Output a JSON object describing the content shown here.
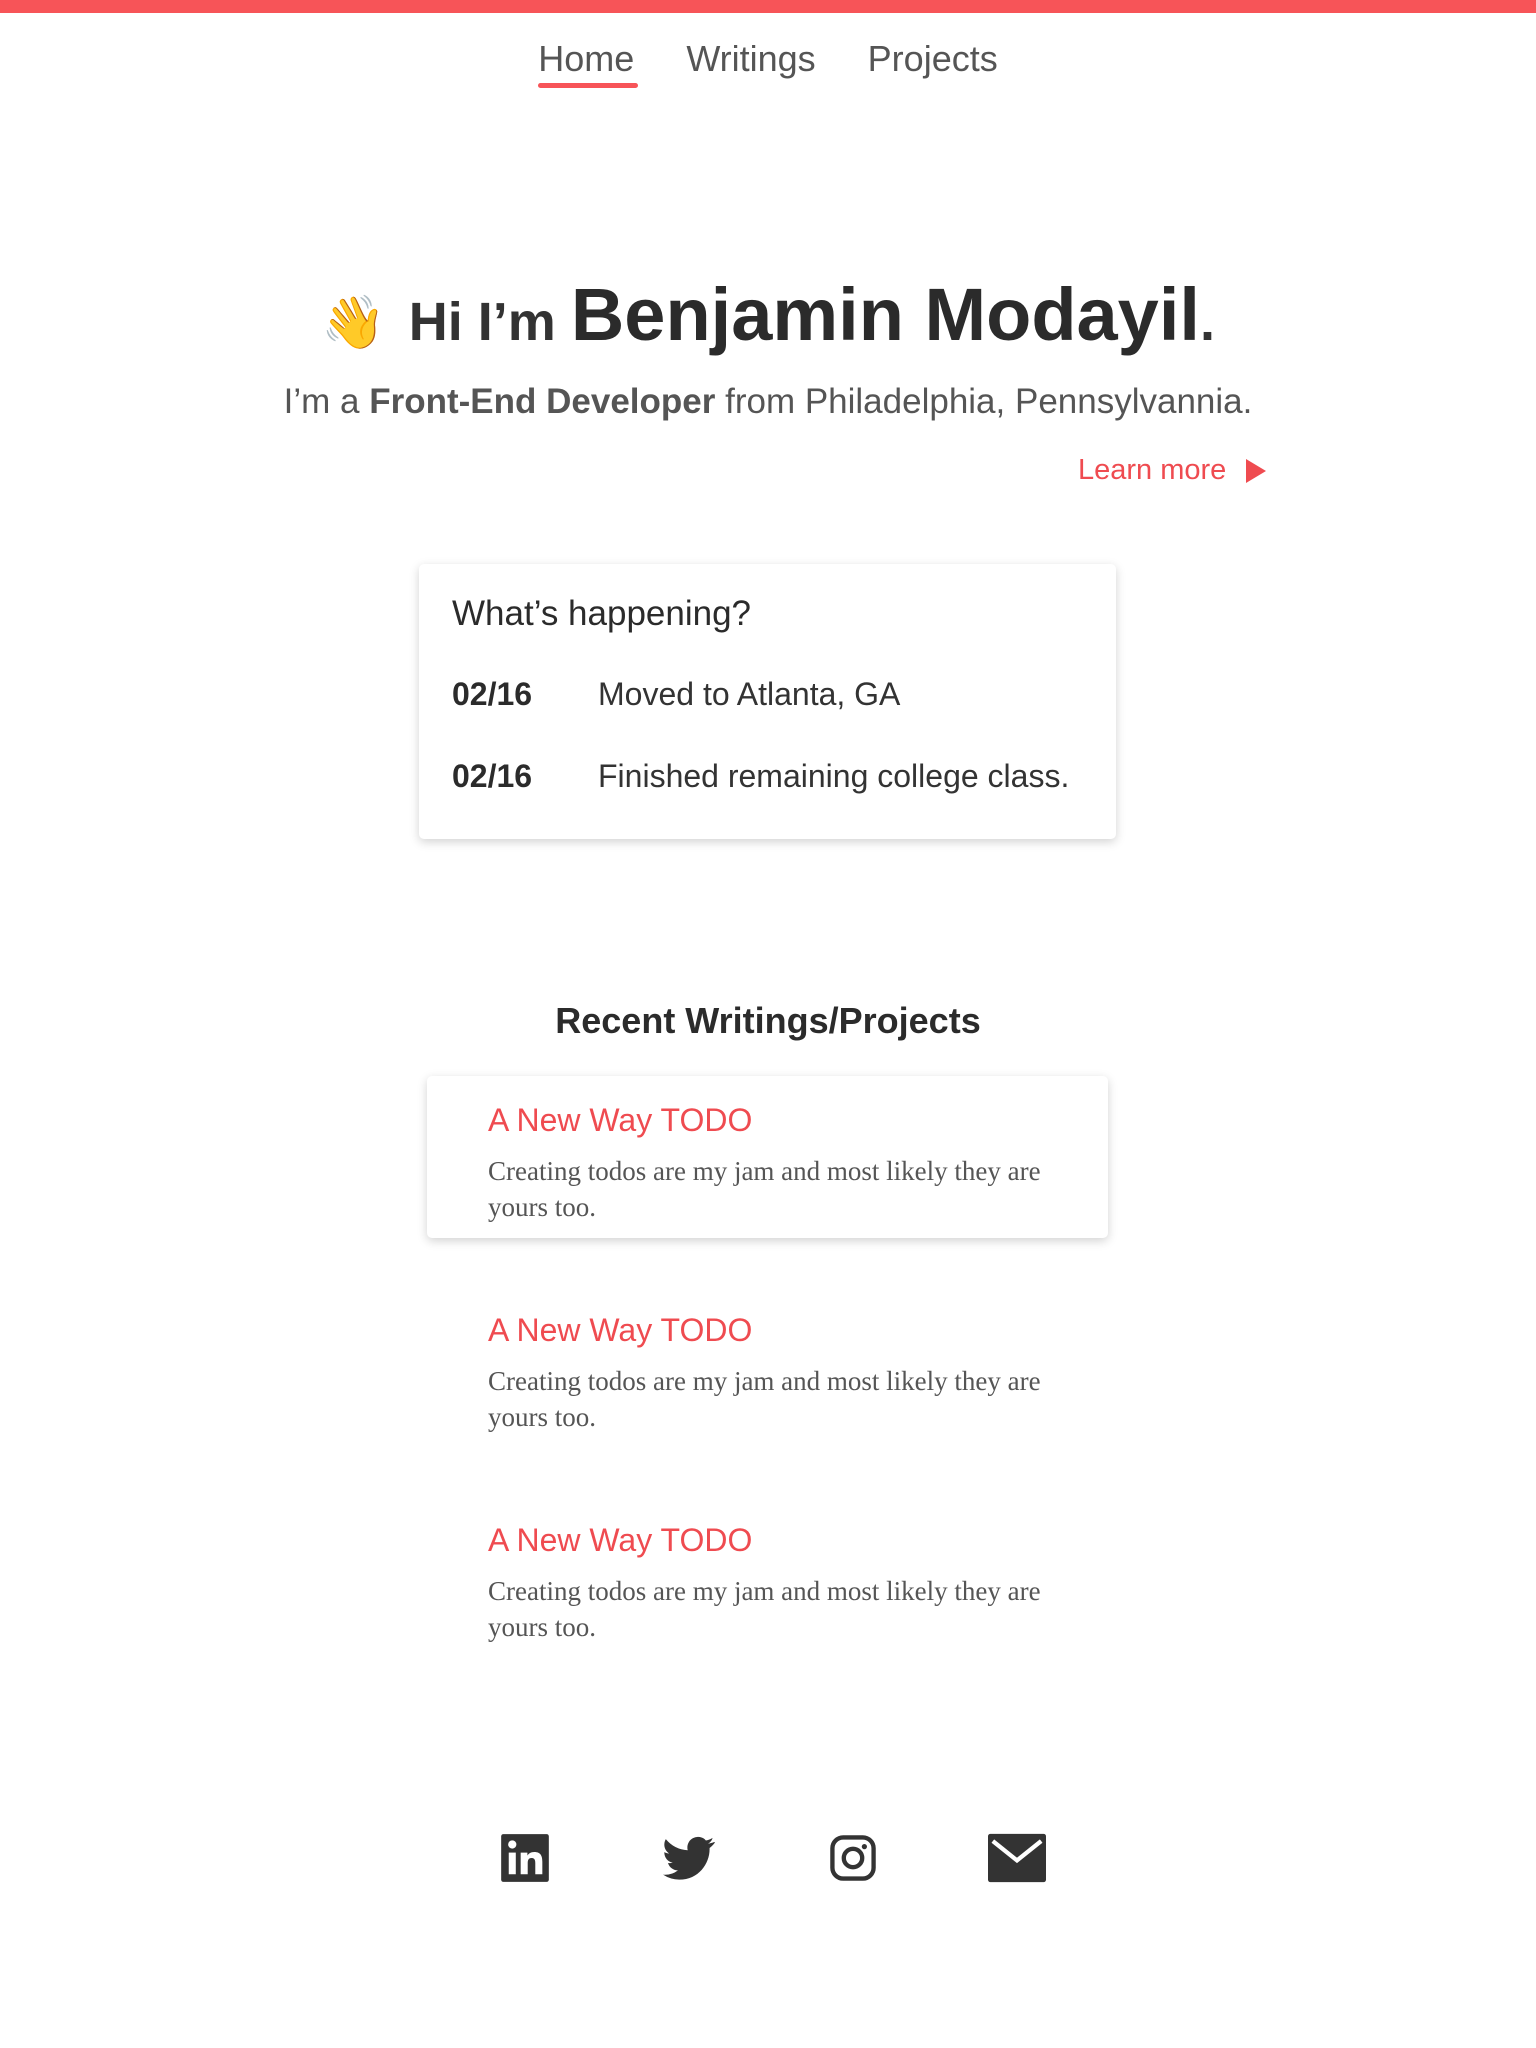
{
  "colors": {
    "accent": "#f75458",
    "link": "#ef4b50",
    "text": "#2b2b2b",
    "muted": "#555555"
  },
  "nav": {
    "items": [
      {
        "label": "Home",
        "active": true
      },
      {
        "label": "Writings",
        "active": false
      },
      {
        "label": "Projects",
        "active": false
      }
    ]
  },
  "hero": {
    "emoji": "👋",
    "greeting": "Hi I’m",
    "name": "Benjamin Modayil",
    "period": ".",
    "sub_prefix": "I’m a",
    "sub_role": "Front-End Developer",
    "sub_suffix": "from Philadelphia, Pennsylvannia.",
    "learn_more": "Learn more",
    "learn_more_icon": "play-arrow-icon"
  },
  "happening": {
    "title": "What’s happening?",
    "items": [
      {
        "date": "02/16",
        "text": "Moved to Atlanta, GA"
      },
      {
        "date": "02/16",
        "text": "Finished remaining college class."
      }
    ]
  },
  "recent": {
    "title": "Recent Writings/Projects",
    "posts": [
      {
        "title": "A New Way TODO",
        "desc": "Creating todos are my jam and most likely they are yours too.",
        "featured": true
      },
      {
        "title": "A New Way TODO",
        "desc": "Creating todos are my jam and most likely they are yours too.",
        "featured": false
      },
      {
        "title": "A New Way TODO",
        "desc": "Creating todos are my jam and most likely they are yours too.",
        "featured": false
      }
    ]
  },
  "socials": [
    {
      "icon": "linkedin-icon"
    },
    {
      "icon": "twitter-icon"
    },
    {
      "icon": "instagram-icon"
    },
    {
      "icon": "email-icon"
    }
  ]
}
